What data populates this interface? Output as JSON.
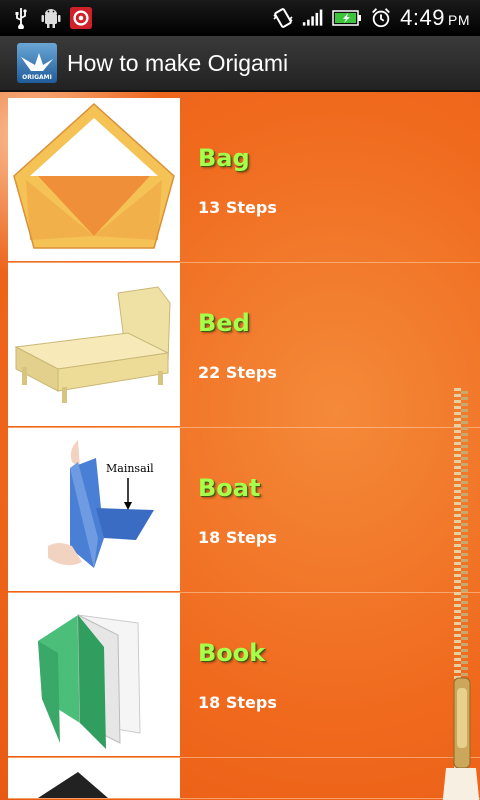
{
  "status_bar": {
    "time": "4:49",
    "ampm": "PM",
    "icons": [
      "usb-icon",
      "android-debug-icon",
      "app-notification-icon",
      "vibrate-icon",
      "signal-icon",
      "battery-charging-icon",
      "alarm-icon"
    ]
  },
  "header": {
    "app_icon_label": "ORIGAMI",
    "title": "How to make Origami"
  },
  "items": [
    {
      "name": "Bag",
      "steps": "13 Steps",
      "thumb": "bag"
    },
    {
      "name": "Bed",
      "steps": "22 Steps",
      "thumb": "bed"
    },
    {
      "name": "Boat",
      "steps": "18 Steps",
      "thumb": "boat",
      "thumb_caption": "Mainsail"
    },
    {
      "name": "Book",
      "steps": "18 Steps",
      "thumb": "book"
    }
  ],
  "colors": {
    "title_green": "#a6ff4a",
    "background_orange": "#f06a1e"
  }
}
